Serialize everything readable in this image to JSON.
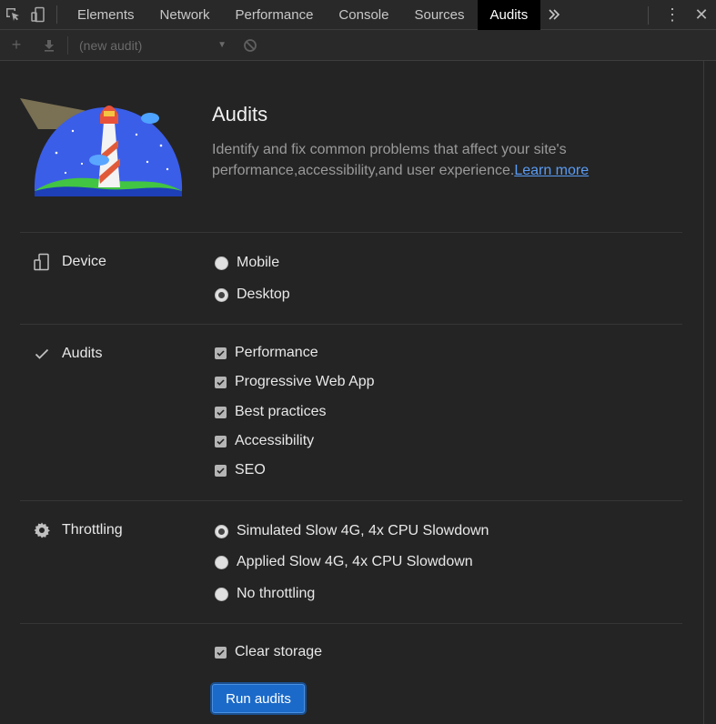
{
  "tabbar": {
    "tabs": [
      {
        "label": "Elements"
      },
      {
        "label": "Network"
      },
      {
        "label": "Performance"
      },
      {
        "label": "Console"
      },
      {
        "label": "Sources"
      },
      {
        "label": "Audits",
        "active": true
      }
    ],
    "more_icon": "chevron-double-right",
    "kebab_icon": "⋮",
    "close_icon": "✕"
  },
  "toolbar": {
    "audit_select": "(new audit)",
    "add_icon": "+",
    "download_icon": "download",
    "clear_icon": "block"
  },
  "header": {
    "title": "Audits",
    "description": "Identify and fix common problems that affect your site's performance,accessibility,and user experience.",
    "learn_more": "Learn more"
  },
  "device": {
    "label": "Device",
    "options": [
      {
        "label": "Mobile",
        "checked": false
      },
      {
        "label": "Desktop",
        "checked": true
      }
    ]
  },
  "audits": {
    "label": "Audits",
    "options": [
      {
        "label": "Performance",
        "checked": true
      },
      {
        "label": "Progressive Web App",
        "checked": true
      },
      {
        "label": "Best practices",
        "checked": true
      },
      {
        "label": "Accessibility",
        "checked": true
      },
      {
        "label": "SEO",
        "checked": true
      }
    ]
  },
  "throttling": {
    "label": "Throttling",
    "options": [
      {
        "label": "Simulated Slow 4G, 4x CPU Slowdown",
        "checked": true
      },
      {
        "label": "Applied Slow 4G, 4x CPU Slowdown",
        "checked": false
      },
      {
        "label": "No throttling",
        "checked": false
      }
    ]
  },
  "footer": {
    "clear_storage": {
      "label": "Clear storage",
      "checked": true
    },
    "run_button": "Run audits"
  },
  "colors": {
    "accent": "#1b6ac9",
    "link": "#5a9cf5",
    "active_tab_bg": "#000000"
  }
}
